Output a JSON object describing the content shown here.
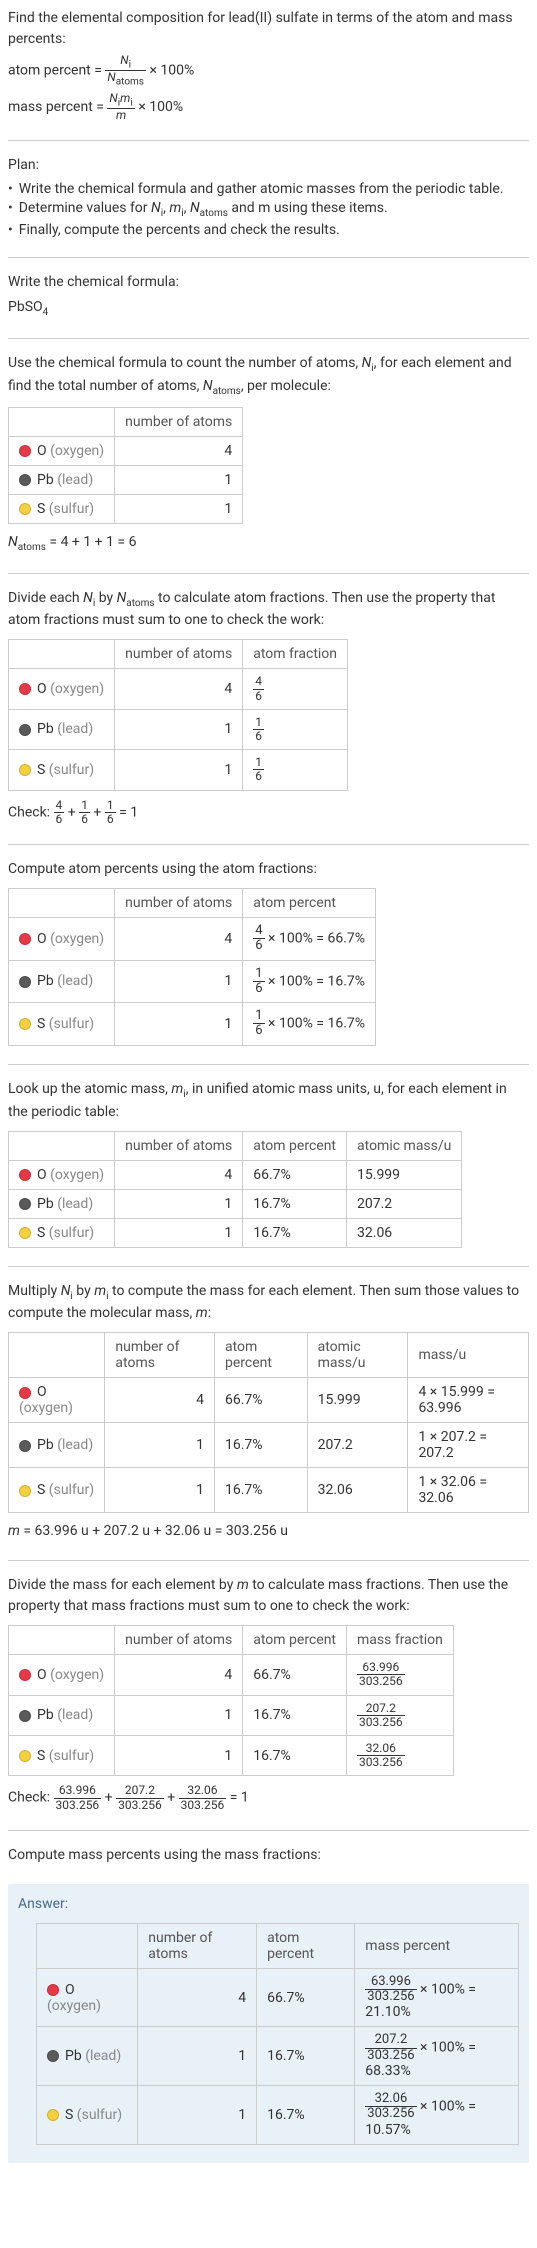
{
  "intro": {
    "line1": "Find the elemental composition for lead(II) sulfate in terms of the atom and mass percents:",
    "atom_percent_lhs": "atom percent = ",
    "atom_percent_rhs": " × 100%",
    "mass_percent_lhs": "mass percent = ",
    "mass_percent_rhs": " × 100%",
    "frac_ap_num": "N_i",
    "frac_ap_den": "N_atoms",
    "frac_mp_num": "N_i m_i",
    "frac_mp_den": "m"
  },
  "plan": {
    "title": "Plan:",
    "b1": "Write the chemical formula and gather atomic masses from the periodic table.",
    "b2_pre": "Determine values for ",
    "b2_vars": "N_i, m_i, N_atoms",
    "b2_post": " and m using these items.",
    "b3": "Finally, compute the percents and check the results."
  },
  "formula": {
    "title": "Write the chemical formula:",
    "value": "PbSO",
    "sub": "4"
  },
  "count": {
    "intro_a": "Use the chemical formula to count the number of atoms, ",
    "intro_b": ", for each element and find the total number of atoms, ",
    "intro_c": ", per molecule:",
    "h1": "number of atoms",
    "rows": [
      {
        "el": "O",
        "name": "(oxygen)",
        "n": "4"
      },
      {
        "el": "Pb",
        "name": "(lead)",
        "n": "1"
      },
      {
        "el": "S",
        "name": "(sulfur)",
        "n": "1"
      }
    ],
    "sum": " = 4 + 1 + 1 = 6"
  },
  "atomfrac": {
    "intro_a": "Divide each ",
    "intro_b": " by ",
    "intro_c": " to calculate atom fractions. Then use the property that atom fractions must sum to one to check the work:",
    "h1": "number of atoms",
    "h2": "atom fraction",
    "rows": [
      {
        "el": "O",
        "name": "(oxygen)",
        "n": "4",
        "fn": "4",
        "fd": "6"
      },
      {
        "el": "Pb",
        "name": "(lead)",
        "n": "1",
        "fn": "1",
        "fd": "6"
      },
      {
        "el": "S",
        "name": "(sulfur)",
        "n": "1",
        "fn": "1",
        "fd": "6"
      }
    ],
    "check_label": "Check: ",
    "check_eq": " = 1"
  },
  "atompct": {
    "intro": "Compute atom percents using the atom fractions:",
    "h1": "number of atoms",
    "h2": "atom percent",
    "rows": [
      {
        "el": "O",
        "name": "(oxygen)",
        "n": "4",
        "fn": "4",
        "fd": "6",
        "res": " × 100% = 66.7%"
      },
      {
        "el": "Pb",
        "name": "(lead)",
        "n": "1",
        "fn": "1",
        "fd": "6",
        "res": " × 100% = 16.7%"
      },
      {
        "el": "S",
        "name": "(sulfur)",
        "n": "1",
        "fn": "1",
        "fd": "6",
        "res": " × 100% = 16.7%"
      }
    ]
  },
  "atomicmass": {
    "intro_a": "Look up the atomic mass, ",
    "intro_b": ", in unified atomic mass units, u, for each element in the periodic table:",
    "h1": "number of atoms",
    "h2": "atom percent",
    "h3": "atomic mass/u",
    "rows": [
      {
        "el": "O",
        "name": "(oxygen)",
        "n": "4",
        "p": "66.7%",
        "m": "15.999"
      },
      {
        "el": "Pb",
        "name": "(lead)",
        "n": "1",
        "p": "16.7%",
        "m": "207.2"
      },
      {
        "el": "S",
        "name": "(sulfur)",
        "n": "1",
        "p": "16.7%",
        "m": "32.06"
      }
    ]
  },
  "masscalc": {
    "intro_a": "Multiply ",
    "intro_b": " by ",
    "intro_c": " to compute the mass for each element. Then sum those values to compute the molecular mass, ",
    "intro_d": ":",
    "h1": "number of atoms",
    "h2": "atom percent",
    "h3": "atomic mass/u",
    "h4": "mass/u",
    "rows": [
      {
        "el": "O",
        "name": "(oxygen)",
        "n": "4",
        "p": "66.7%",
        "m": "15.999",
        "mu": "4 × 15.999 = 63.996"
      },
      {
        "el": "Pb",
        "name": "(lead)",
        "n": "1",
        "p": "16.7%",
        "m": "207.2",
        "mu": "1 × 207.2 = 207.2"
      },
      {
        "el": "S",
        "name": "(sulfur)",
        "n": "1",
        "p": "16.7%",
        "m": "32.06",
        "mu": "1 × 32.06 = 32.06"
      }
    ],
    "msum": " = 63.996 u + 207.2 u + 32.06 u = 303.256 u"
  },
  "massfrac": {
    "intro_a": "Divide the mass for each element by ",
    "intro_b": " to calculate mass fractions. Then use the property that mass fractions must sum to one to check the work:",
    "h1": "number of atoms",
    "h2": "atom percent",
    "h3": "mass fraction",
    "rows": [
      {
        "el": "O",
        "name": "(oxygen)",
        "n": "4",
        "p": "66.7%",
        "fn": "63.996",
        "fd": "303.256"
      },
      {
        "el": "Pb",
        "name": "(lead)",
        "n": "1",
        "p": "16.7%",
        "fn": "207.2",
        "fd": "303.256"
      },
      {
        "el": "S",
        "name": "(sulfur)",
        "n": "1",
        "p": "16.7%",
        "fn": "32.06",
        "fd": "303.256"
      }
    ],
    "check_label": "Check: ",
    "check_eq": " = 1"
  },
  "masspct": {
    "intro": "Compute mass percents using the mass fractions:"
  },
  "answer": {
    "label": "Answer:",
    "h1": "number of atoms",
    "h2": "atom percent",
    "h3": "mass percent",
    "rows": [
      {
        "el": "O",
        "name": "(oxygen)",
        "n": "4",
        "p": "66.7%",
        "fn": "63.996",
        "fd": "303.256",
        "res": " × 100% = 21.10%"
      },
      {
        "el": "Pb",
        "name": "(lead)",
        "n": "1",
        "p": "16.7%",
        "fn": "207.2",
        "fd": "303.256",
        "res": " × 100% = 68.33%"
      },
      {
        "el": "S",
        "name": "(sulfur)",
        "n": "1",
        "p": "16.7%",
        "fn": "32.06",
        "fd": "303.256",
        "res": " × 100% = 10.57%"
      }
    ]
  }
}
